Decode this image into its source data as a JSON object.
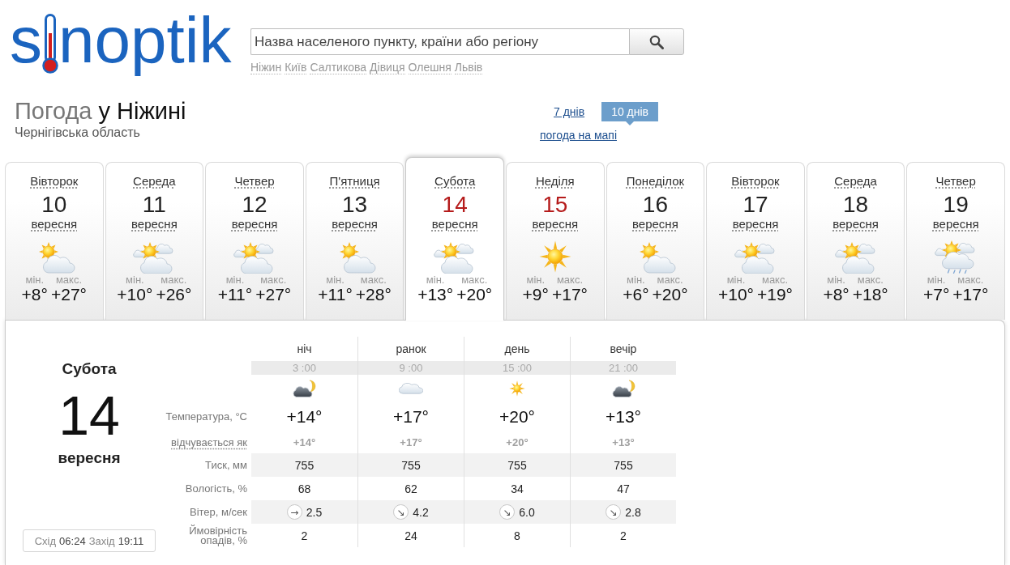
{
  "logo": {
    "left": "s",
    "right": "noptik"
  },
  "search": {
    "placeholder": "Назва населеного пункту, країни або регіону"
  },
  "recent_cities": [
    "Ніжин",
    "Київ",
    "Салтикова",
    "Дівиця",
    "Олешня",
    "Львів"
  ],
  "heading": {
    "prefix": "Погода",
    "city": "у Ніжині",
    "region": "Чернігівська область"
  },
  "range_tabs": [
    {
      "label": "7 днів",
      "selected": false
    },
    {
      "label": "10 днів",
      "selected": true
    }
  ],
  "map_link": "погода на мапі",
  "days": [
    {
      "weekday": "Вівторок",
      "date": "10",
      "month": "вересня",
      "kind": "sun-cloud",
      "min_label": "мін.",
      "min": "+8°",
      "max_label": "макс.",
      "max": "+27°",
      "weekend": false,
      "selected": false
    },
    {
      "weekday": "Середа",
      "date": "11",
      "month": "вересня",
      "kind": "sun-clouds",
      "min_label": "мін.",
      "min": "+10°",
      "max_label": "макс.",
      "max": "+26°",
      "weekend": false,
      "selected": false
    },
    {
      "weekday": "Четвер",
      "date": "12",
      "month": "вересня",
      "kind": "sun-clouds",
      "min_label": "мін.",
      "min": "+11°",
      "max_label": "макс.",
      "max": "+27°",
      "weekend": false,
      "selected": false
    },
    {
      "weekday": "П'ятниця",
      "date": "13",
      "month": "вересня",
      "kind": "sun-cloud",
      "min_label": "мін.",
      "min": "+11°",
      "max_label": "макс.",
      "max": "+28°",
      "weekend": false,
      "selected": false
    },
    {
      "weekday": "Субота",
      "date": "14",
      "month": "вересня",
      "kind": "sun-clouds",
      "min_label": "мін.",
      "min": "+13°",
      "max_label": "макс.",
      "max": "+20°",
      "weekend": true,
      "selected": true
    },
    {
      "weekday": "Неділя",
      "date": "15",
      "month": "вересня",
      "kind": "sun",
      "min_label": "мін.",
      "min": "+9°",
      "max_label": "макс.",
      "max": "+17°",
      "weekend": true,
      "selected": false
    },
    {
      "weekday": "Понеділок",
      "date": "16",
      "month": "вересня",
      "kind": "sun-cloud",
      "min_label": "мін.",
      "min": "+6°",
      "max_label": "макс.",
      "max": "+20°",
      "weekend": false,
      "selected": false
    },
    {
      "weekday": "Вівторок",
      "date": "17",
      "month": "вересня",
      "kind": "sun-clouds",
      "min_label": "мін.",
      "min": "+10°",
      "max_label": "макс.",
      "max": "+19°",
      "weekend": false,
      "selected": false
    },
    {
      "weekday": "Середа",
      "date": "18",
      "month": "вересня",
      "kind": "sun-clouds",
      "min_label": "мін.",
      "min": "+8°",
      "max_label": "макс.",
      "max": "+18°",
      "weekend": false,
      "selected": false
    },
    {
      "weekday": "Четвер",
      "date": "19",
      "month": "вересня",
      "kind": "sun-clouds-rain",
      "min_label": "мін.",
      "min": "+7°",
      "max_label": "макс.",
      "max": "+17°",
      "weekend": false,
      "selected": false
    }
  ],
  "detail": {
    "weekday": "Субота",
    "date": "14",
    "month": "вересня",
    "sunrise_label": "Схід",
    "sunrise": "06:24",
    "sunset_label": "Захід",
    "sunset": "19:11",
    "row_labels": {
      "temperature": "Температура, °C",
      "feels_like": "відчувається як",
      "pressure": "Тиск, мм",
      "humidity": "Вологість, %",
      "wind": "Вітер, м/сек",
      "precipitation": "Ймовірність опадів, %"
    },
    "periods": [
      {
        "name": "ніч",
        "time": "3 :00",
        "kind": "moon-cloud",
        "temperature": "+14°",
        "feels_like": "+14°",
        "pressure": "755",
        "humidity": "68",
        "wind_arrow": "→",
        "wind": "2.5",
        "precipitation": "2"
      },
      {
        "name": "ранок",
        "time": "9 :00",
        "kind": "cloud",
        "temperature": "+17°",
        "feels_like": "+17°",
        "pressure": "755",
        "humidity": "62",
        "wind_arrow": "↘",
        "wind": "4.2",
        "precipitation": "24"
      },
      {
        "name": "день",
        "time": "15 :00",
        "kind": "sun",
        "temperature": "+20°",
        "feels_like": "+20°",
        "pressure": "755",
        "humidity": "34",
        "wind_arrow": "↘",
        "wind": "6.0",
        "precipitation": "8"
      },
      {
        "name": "вечір",
        "time": "21 :00",
        "kind": "moon-cloud",
        "temperature": "+13°",
        "feels_like": "+13°",
        "pressure": "755",
        "humidity": "47",
        "wind_arrow": "↘",
        "wind": "2.8",
        "precipitation": "2"
      }
    ]
  }
}
